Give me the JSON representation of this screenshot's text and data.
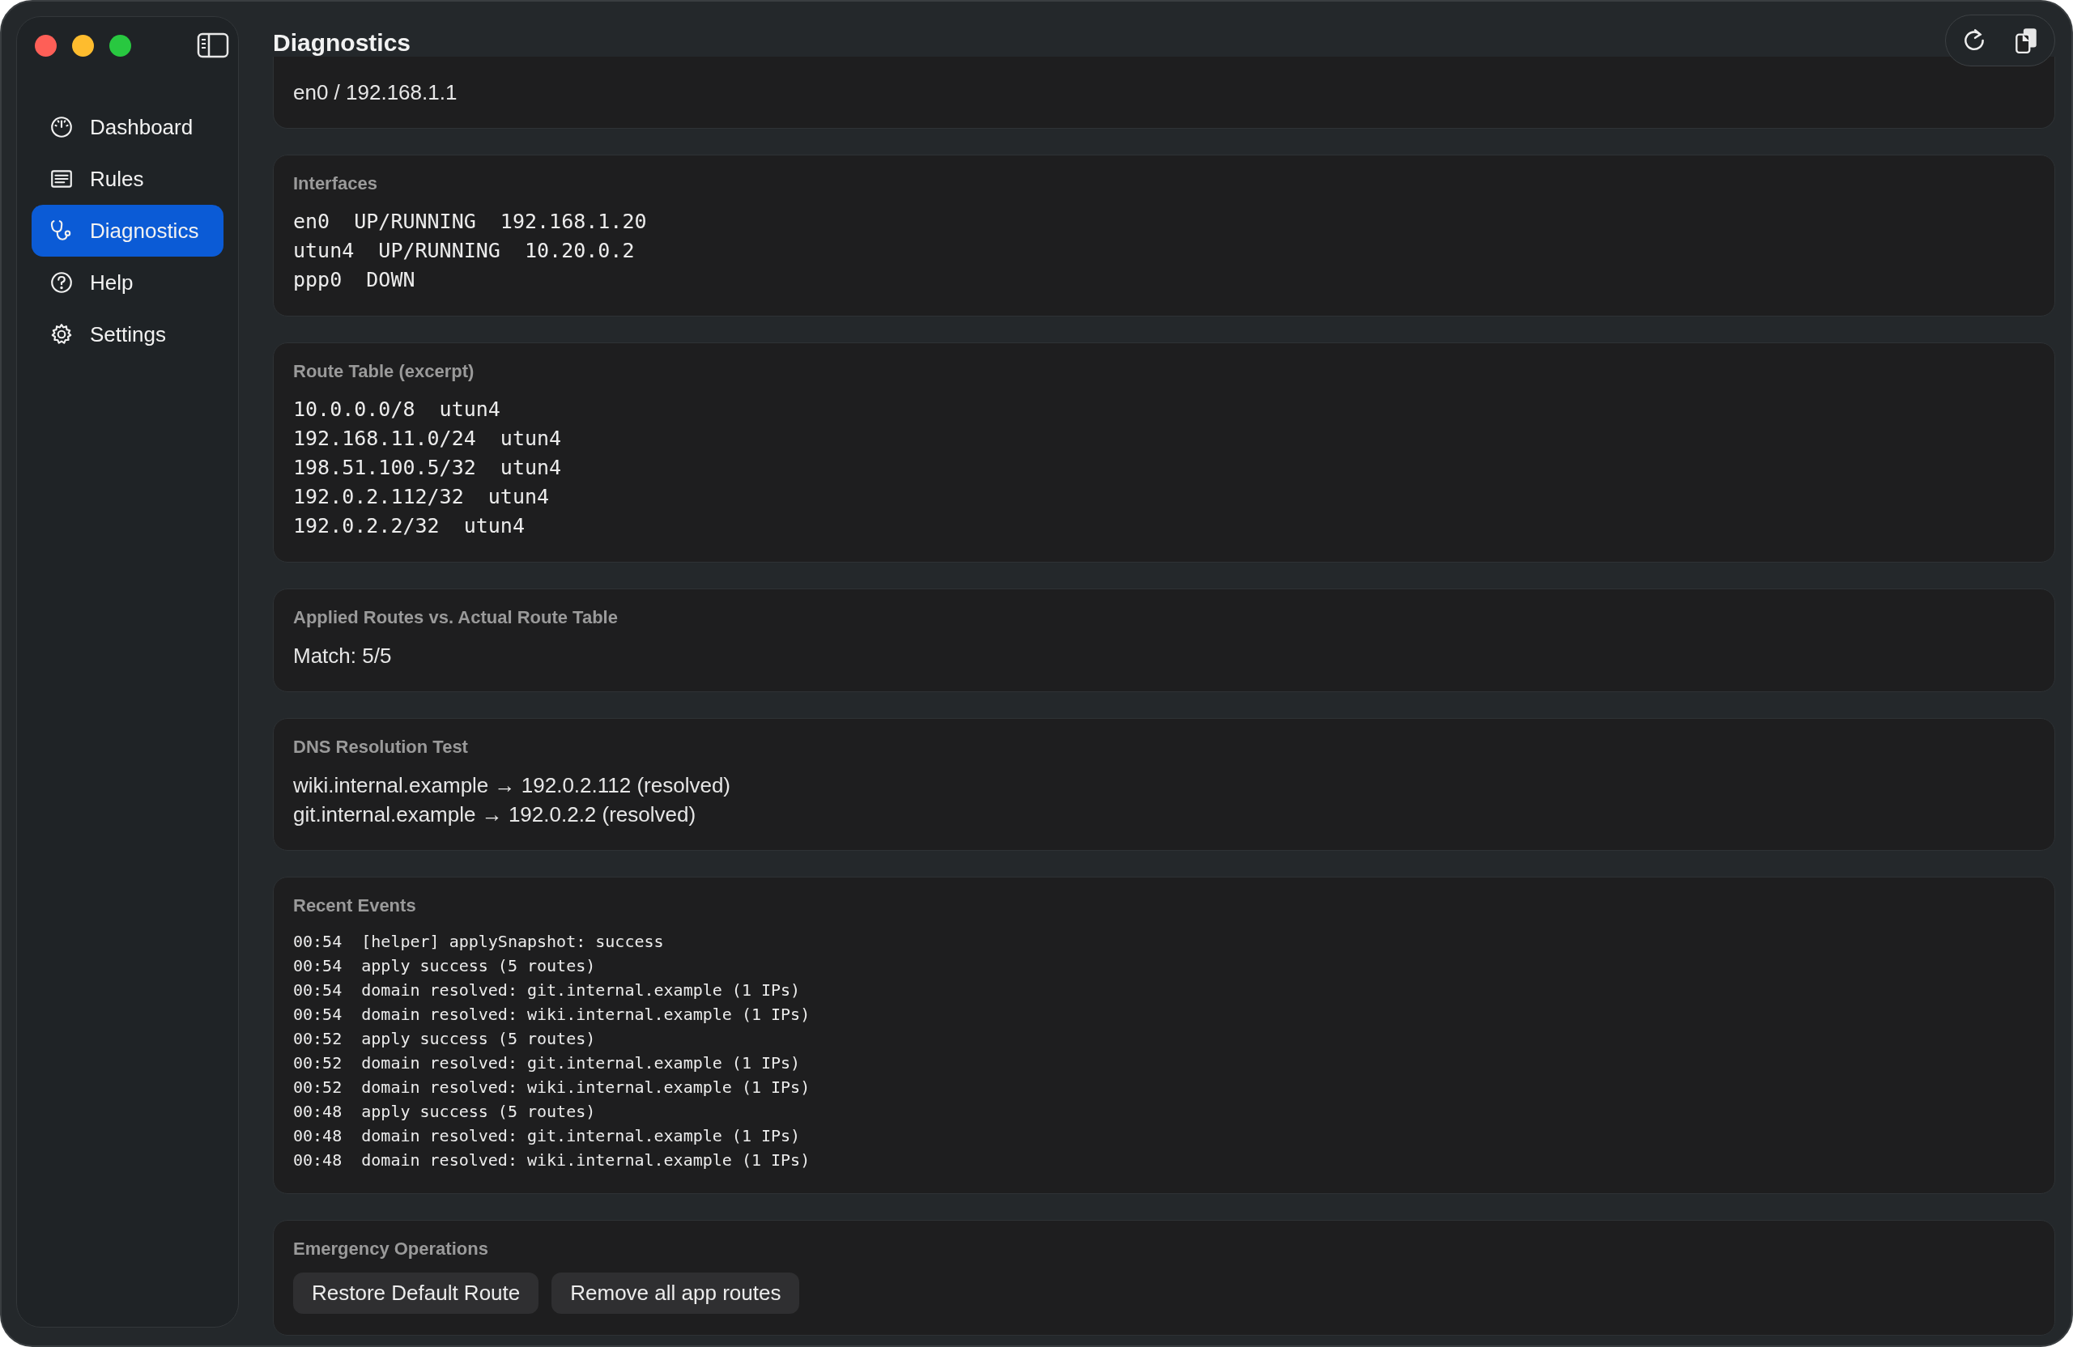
{
  "window": {
    "title": "Diagnostics"
  },
  "sidebar": {
    "items": [
      {
        "label": "Dashboard",
        "kind": "gauge",
        "selected": false
      },
      {
        "label": "Rules",
        "kind": "list",
        "selected": false
      },
      {
        "label": "Diagnostics",
        "kind": "stethoscope",
        "selected": true
      },
      {
        "label": "Help",
        "kind": "help",
        "selected": false
      },
      {
        "label": "Settings",
        "kind": "gear",
        "selected": false
      }
    ]
  },
  "sections": [
    {
      "kind": "text",
      "lines": [
        "en0 / 192.168.1.1"
      ]
    },
    {
      "kind": "mono",
      "title": "Interfaces",
      "lines": [
        "en0  UP/RUNNING  192.168.1.20",
        "utun4  UP/RUNNING  10.20.0.2",
        "ppp0  DOWN"
      ]
    },
    {
      "kind": "mono",
      "title": "Route Table (excerpt)",
      "lines": [
        "10.0.0.0/8  utun4",
        "192.168.11.0/24  utun4",
        "198.51.100.5/32  utun4",
        "192.0.2.112/32  utun4",
        "192.0.2.2/32  utun4"
      ]
    },
    {
      "kind": "text",
      "title": "Applied Routes vs. Actual Route Table",
      "lines": [
        "Match: 5/5"
      ]
    },
    {
      "kind": "text",
      "title": "DNS Resolution Test",
      "lines": [
        "wiki.internal.example → 192.0.2.112 (resolved)",
        "git.internal.example → 192.0.2.2 (resolved)"
      ]
    },
    {
      "kind": "log",
      "title": "Recent Events",
      "lines": [
        "00:54  [helper] applySnapshot: success",
        "00:54  apply success (5 routes)",
        "00:54  domain resolved: git.internal.example (1 IPs)",
        "00:54  domain resolved: wiki.internal.example (1 IPs)",
        "00:52  apply success (5 routes)",
        "00:52  domain resolved: git.internal.example (1 IPs)",
        "00:52  domain resolved: wiki.internal.example (1 IPs)",
        "00:48  apply success (5 routes)",
        "00:48  domain resolved: git.internal.example (1 IPs)",
        "00:48  domain resolved: wiki.internal.example (1 IPs)"
      ]
    },
    {
      "kind": "buttons",
      "title": "Emergency Operations",
      "buttons": [
        "Restore Default Route",
        "Remove all app routes"
      ]
    }
  ]
}
